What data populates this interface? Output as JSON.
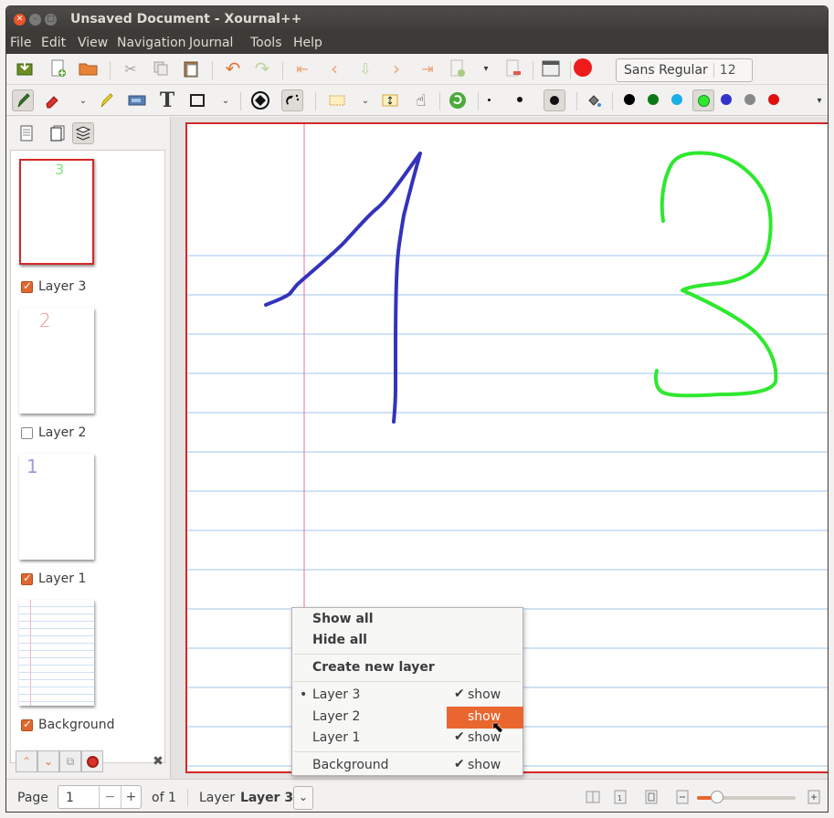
{
  "window": {
    "title": "Unsaved Document - Xournal++"
  },
  "menubar": [
    "File",
    "Edit",
    "View",
    "Navigation",
    "Journal",
    "Tools",
    "Help"
  ],
  "toolbar": {
    "font_name": "Sans Regular",
    "font_size": "12"
  },
  "sidebar": {
    "layers": [
      {
        "label": "Layer 3",
        "checked": true,
        "mark": "3"
      },
      {
        "label": "Layer 2",
        "checked": false,
        "mark": "2"
      },
      {
        "label": "Layer 1",
        "checked": true,
        "mark": "1"
      },
      {
        "label": "Background",
        "checked": true,
        "mark": ""
      }
    ]
  },
  "canvas": {
    "stroke1": "1",
    "stroke3": "3",
    "stroke1_color": "#3333bb",
    "stroke3_color": "#2ee82e"
  },
  "popup": {
    "show_all": "Show all",
    "hide_all": "Hide all",
    "create": "Create new layer",
    "rows": [
      {
        "label": "Layer 3",
        "show": "show",
        "check": "✔",
        "current": "•"
      },
      {
        "label": "Layer 2",
        "show": "show",
        "check": "",
        "current": ""
      },
      {
        "label": "Layer 1",
        "show": "show",
        "check": "✔",
        "current": ""
      },
      {
        "label": "Background",
        "show": "show",
        "check": "✔",
        "current": ""
      }
    ]
  },
  "status": {
    "page_label": "Page",
    "page_value": "1",
    "of_label": "of 1",
    "layer_label": "Layer",
    "layer_value": "Layer 3",
    "zoom_fraction": 0.2
  },
  "colors": {
    "accent": "#e9672f",
    "page_border": "#d52828",
    "ruling": "#9cc4ee",
    "margin": "#ee6da3"
  }
}
